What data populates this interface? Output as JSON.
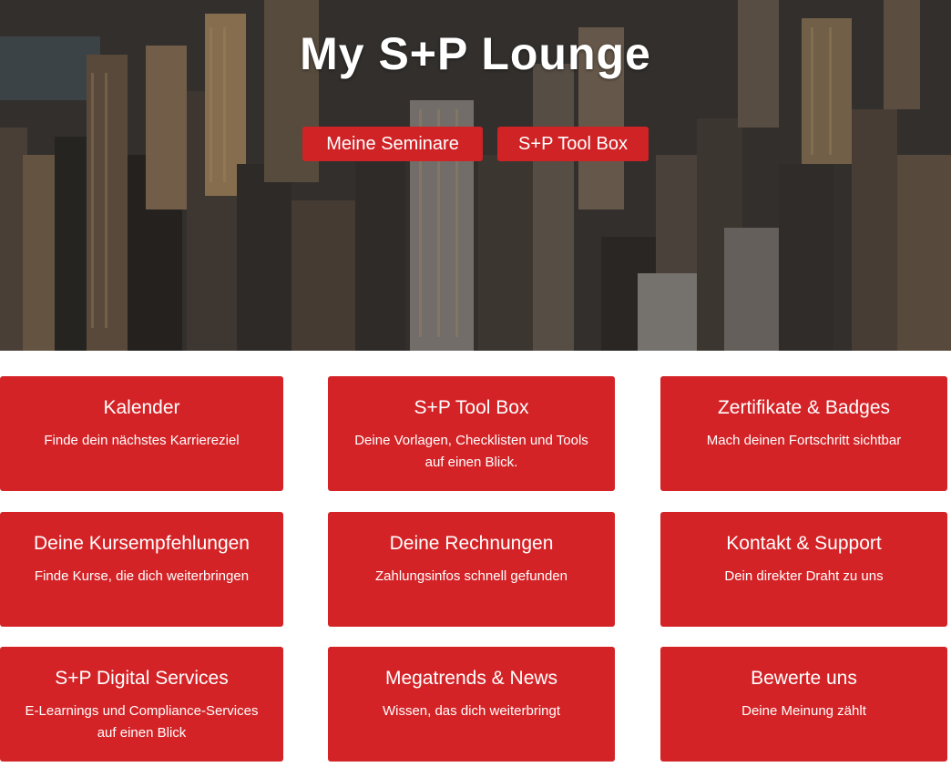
{
  "hero": {
    "title": "My S+P Lounge",
    "buttons": [
      {
        "label": "Meine Seminare"
      },
      {
        "label": "S+P Tool Box"
      }
    ]
  },
  "cards": [
    {
      "title": "Kalender",
      "subtitle": "Finde dein nächstes Karriereziel"
    },
    {
      "title": "S+P Tool Box",
      "subtitle": "Deine Vorlagen, Checklisten und Tools auf einen Blick."
    },
    {
      "title": "Zertifikate & Badges",
      "subtitle": "Mach deinen Fortschritt sichtbar"
    },
    {
      "title": "Deine Kursempfehlungen",
      "subtitle": "Finde Kurse, die dich weiterbringen"
    },
    {
      "title": "Deine Rechnungen",
      "subtitle": "Zahlungsinfos schnell gefunden"
    },
    {
      "title": "Kontakt & Support",
      "subtitle": "Dein direkter Draht zu uns"
    },
    {
      "title": "S+P Digital Services",
      "subtitle": "E-Learnings und Compliance-Services auf einen Blick"
    },
    {
      "title": "Megatrends & News",
      "subtitle": "Wissen, das dich weiterbringt"
    },
    {
      "title": "Bewerte uns",
      "subtitle": "Deine Meinung zählt"
    }
  ],
  "colors": {
    "accent": "#d42327",
    "hero_button": "#cf2326"
  }
}
